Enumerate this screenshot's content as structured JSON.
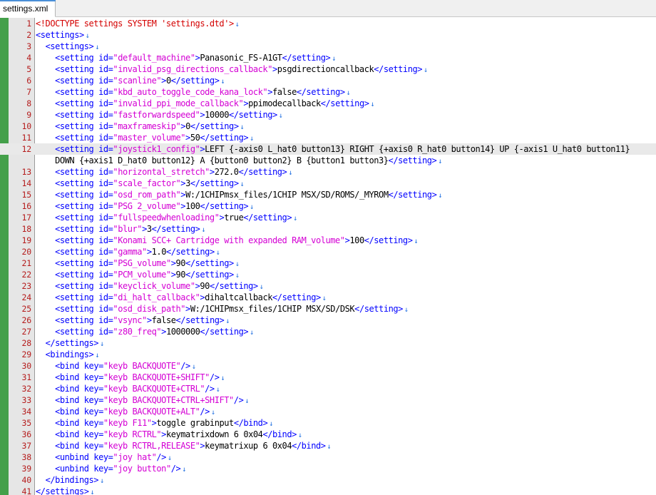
{
  "tab": {
    "title": "settings.xml"
  },
  "editor": {
    "current_line": 12,
    "eol_marker": "↓",
    "lines": [
      {
        "n": "1",
        "parts": [
          [
            "doc",
            "<!DOCTYPE settings SYSTEM 'settings.dtd'>"
          ]
        ]
      },
      {
        "n": "2",
        "parts": [
          [
            "tag",
            "<settings>"
          ]
        ]
      },
      {
        "n": "3",
        "parts": [
          [
            "txt",
            "  "
          ],
          [
            "tag",
            "<settings>"
          ]
        ]
      },
      {
        "n": "4",
        "parts": [
          [
            "txt",
            "    "
          ],
          [
            "tag",
            "<setting "
          ],
          [
            "attr",
            "id="
          ],
          [
            "val",
            "\"default_machine\""
          ],
          [
            "tag",
            ">"
          ],
          [
            "txt",
            "Panasonic_FS-A1GT"
          ],
          [
            "tag",
            "</setting>"
          ]
        ]
      },
      {
        "n": "5",
        "parts": [
          [
            "txt",
            "    "
          ],
          [
            "tag",
            "<setting "
          ],
          [
            "attr",
            "id="
          ],
          [
            "val",
            "\"invalid_psg_directions_callback\""
          ],
          [
            "tag",
            ">"
          ],
          [
            "txt",
            "psgdirectioncallback"
          ],
          [
            "tag",
            "</setting>"
          ]
        ]
      },
      {
        "n": "6",
        "parts": [
          [
            "txt",
            "    "
          ],
          [
            "tag",
            "<setting "
          ],
          [
            "attr",
            "id="
          ],
          [
            "val",
            "\"scanline\""
          ],
          [
            "tag",
            ">"
          ],
          [
            "txt",
            "0"
          ],
          [
            "tag",
            "</setting>"
          ]
        ]
      },
      {
        "n": "7",
        "parts": [
          [
            "txt",
            "    "
          ],
          [
            "tag",
            "<setting "
          ],
          [
            "attr",
            "id="
          ],
          [
            "val",
            "\"kbd_auto_toggle_code_kana_lock\""
          ],
          [
            "tag",
            ">"
          ],
          [
            "txt",
            "false"
          ],
          [
            "tag",
            "</setting>"
          ]
        ]
      },
      {
        "n": "8",
        "parts": [
          [
            "txt",
            "    "
          ],
          [
            "tag",
            "<setting "
          ],
          [
            "attr",
            "id="
          ],
          [
            "val",
            "\"invalid_ppi_mode_callback\""
          ],
          [
            "tag",
            ">"
          ],
          [
            "txt",
            "ppimodecallback"
          ],
          [
            "tag",
            "</setting>"
          ]
        ]
      },
      {
        "n": "9",
        "parts": [
          [
            "txt",
            "    "
          ],
          [
            "tag",
            "<setting "
          ],
          [
            "attr",
            "id="
          ],
          [
            "val",
            "\"fastforwardspeed\""
          ],
          [
            "tag",
            ">"
          ],
          [
            "txt",
            "10000"
          ],
          [
            "tag",
            "</setting>"
          ]
        ]
      },
      {
        "n": "10",
        "parts": [
          [
            "txt",
            "    "
          ],
          [
            "tag",
            "<setting "
          ],
          [
            "attr",
            "id="
          ],
          [
            "val",
            "\"maxframeskip\""
          ],
          [
            "tag",
            ">"
          ],
          [
            "txt",
            "0"
          ],
          [
            "tag",
            "</setting>"
          ]
        ]
      },
      {
        "n": "11",
        "parts": [
          [
            "txt",
            "    "
          ],
          [
            "tag",
            "<setting "
          ],
          [
            "attr",
            "id="
          ],
          [
            "val",
            "\"master_volume\""
          ],
          [
            "tag",
            ">"
          ],
          [
            "txt",
            "50"
          ],
          [
            "tag",
            "</setting>"
          ]
        ]
      },
      {
        "n": "12",
        "parts": [
          [
            "txt",
            "    "
          ],
          [
            "tag",
            "<setting "
          ],
          [
            "attr",
            "id="
          ],
          [
            "val",
            "\"joystick1_config\""
          ],
          [
            "tag",
            ">"
          ],
          [
            "txt",
            "LEFT {-axis0 L_hat0 button13} RIGHT {+axis0 R_hat0 button14} UP {-axis1 U_hat0 button11}"
          ]
        ],
        "noeol": true
      },
      {
        "n": "",
        "cont": true,
        "parts": [
          [
            "txt",
            "    DOWN {+axis1 D_hat0 button12} A {button0 button2} B {button1 button3}"
          ],
          [
            "tag",
            "</setting>"
          ]
        ]
      },
      {
        "n": "13",
        "parts": [
          [
            "txt",
            "    "
          ],
          [
            "tag",
            "<setting "
          ],
          [
            "attr",
            "id="
          ],
          [
            "val",
            "\"horizontal_stretch\""
          ],
          [
            "tag",
            ">"
          ],
          [
            "txt",
            "272.0"
          ],
          [
            "tag",
            "</setting>"
          ]
        ]
      },
      {
        "n": "14",
        "parts": [
          [
            "txt",
            "    "
          ],
          [
            "tag",
            "<setting "
          ],
          [
            "attr",
            "id="
          ],
          [
            "val",
            "\"scale_factor\""
          ],
          [
            "tag",
            ">"
          ],
          [
            "txt",
            "3"
          ],
          [
            "tag",
            "</setting>"
          ]
        ]
      },
      {
        "n": "15",
        "parts": [
          [
            "txt",
            "    "
          ],
          [
            "tag",
            "<setting "
          ],
          [
            "attr",
            "id="
          ],
          [
            "val",
            "\"osd_rom_path\""
          ],
          [
            "tag",
            ">"
          ],
          [
            "txt",
            "W:/1CHIPmsx_files/1CHIP MSX/SD/ROMS/_MYROM"
          ],
          [
            "tag",
            "</setting>"
          ]
        ]
      },
      {
        "n": "16",
        "parts": [
          [
            "txt",
            "    "
          ],
          [
            "tag",
            "<setting "
          ],
          [
            "attr",
            "id="
          ],
          [
            "val",
            "\"PSG 2_volume\""
          ],
          [
            "tag",
            ">"
          ],
          [
            "txt",
            "100"
          ],
          [
            "tag",
            "</setting>"
          ]
        ]
      },
      {
        "n": "17",
        "parts": [
          [
            "txt",
            "    "
          ],
          [
            "tag",
            "<setting "
          ],
          [
            "attr",
            "id="
          ],
          [
            "val",
            "\"fullspeedwhenloading\""
          ],
          [
            "tag",
            ">"
          ],
          [
            "txt",
            "true"
          ],
          [
            "tag",
            "</setting>"
          ]
        ]
      },
      {
        "n": "18",
        "parts": [
          [
            "txt",
            "    "
          ],
          [
            "tag",
            "<setting "
          ],
          [
            "attr",
            "id="
          ],
          [
            "val",
            "\"blur\""
          ],
          [
            "tag",
            ">"
          ],
          [
            "txt",
            "3"
          ],
          [
            "tag",
            "</setting>"
          ]
        ]
      },
      {
        "n": "19",
        "parts": [
          [
            "txt",
            "    "
          ],
          [
            "tag",
            "<setting "
          ],
          [
            "attr",
            "id="
          ],
          [
            "val",
            "\"Konami SCC+ Cartridge with expanded RAM_volume\""
          ],
          [
            "tag",
            ">"
          ],
          [
            "txt",
            "100"
          ],
          [
            "tag",
            "</setting>"
          ]
        ]
      },
      {
        "n": "20",
        "parts": [
          [
            "txt",
            "    "
          ],
          [
            "tag",
            "<setting "
          ],
          [
            "attr",
            "id="
          ],
          [
            "val",
            "\"gamma\""
          ],
          [
            "tag",
            ">"
          ],
          [
            "txt",
            "1.0"
          ],
          [
            "tag",
            "</setting>"
          ]
        ]
      },
      {
        "n": "21",
        "parts": [
          [
            "txt",
            "    "
          ],
          [
            "tag",
            "<setting "
          ],
          [
            "attr",
            "id="
          ],
          [
            "val",
            "\"PSG_volume\""
          ],
          [
            "tag",
            ">"
          ],
          [
            "txt",
            "90"
          ],
          [
            "tag",
            "</setting>"
          ]
        ]
      },
      {
        "n": "22",
        "parts": [
          [
            "txt",
            "    "
          ],
          [
            "tag",
            "<setting "
          ],
          [
            "attr",
            "id="
          ],
          [
            "val",
            "\"PCM_volume\""
          ],
          [
            "tag",
            ">"
          ],
          [
            "txt",
            "90"
          ],
          [
            "tag",
            "</setting>"
          ]
        ]
      },
      {
        "n": "23",
        "parts": [
          [
            "txt",
            "    "
          ],
          [
            "tag",
            "<setting "
          ],
          [
            "attr",
            "id="
          ],
          [
            "val",
            "\"keyclick_volume\""
          ],
          [
            "tag",
            ">"
          ],
          [
            "txt",
            "90"
          ],
          [
            "tag",
            "</setting>"
          ]
        ]
      },
      {
        "n": "24",
        "parts": [
          [
            "txt",
            "    "
          ],
          [
            "tag",
            "<setting "
          ],
          [
            "attr",
            "id="
          ],
          [
            "val",
            "\"di_halt_callback\""
          ],
          [
            "tag",
            ">"
          ],
          [
            "txt",
            "dihaltcallback"
          ],
          [
            "tag",
            "</setting>"
          ]
        ]
      },
      {
        "n": "25",
        "parts": [
          [
            "txt",
            "    "
          ],
          [
            "tag",
            "<setting "
          ],
          [
            "attr",
            "id="
          ],
          [
            "val",
            "\"osd_disk_path\""
          ],
          [
            "tag",
            ">"
          ],
          [
            "txt",
            "W:/1CHIPmsx_files/1CHIP MSX/SD/DSK"
          ],
          [
            "tag",
            "</setting>"
          ]
        ]
      },
      {
        "n": "26",
        "parts": [
          [
            "txt",
            "    "
          ],
          [
            "tag",
            "<setting "
          ],
          [
            "attr",
            "id="
          ],
          [
            "val",
            "\"vsync\""
          ],
          [
            "tag",
            ">"
          ],
          [
            "txt",
            "false"
          ],
          [
            "tag",
            "</setting>"
          ]
        ]
      },
      {
        "n": "27",
        "parts": [
          [
            "txt",
            "    "
          ],
          [
            "tag",
            "<setting "
          ],
          [
            "attr",
            "id="
          ],
          [
            "val",
            "\"z80_freq\""
          ],
          [
            "tag",
            ">"
          ],
          [
            "txt",
            "1000000"
          ],
          [
            "tag",
            "</setting>"
          ]
        ]
      },
      {
        "n": "28",
        "parts": [
          [
            "txt",
            "  "
          ],
          [
            "tag",
            "</settings>"
          ]
        ]
      },
      {
        "n": "29",
        "parts": [
          [
            "txt",
            "  "
          ],
          [
            "tag",
            "<bindings>"
          ]
        ]
      },
      {
        "n": "30",
        "parts": [
          [
            "txt",
            "    "
          ],
          [
            "tag",
            "<bind "
          ],
          [
            "attr",
            "key="
          ],
          [
            "val",
            "\"keyb BACKQUOTE\""
          ],
          [
            "tag",
            "/>"
          ]
        ]
      },
      {
        "n": "31",
        "parts": [
          [
            "txt",
            "    "
          ],
          [
            "tag",
            "<bind "
          ],
          [
            "attr",
            "key="
          ],
          [
            "val",
            "\"keyb BACKQUOTE+SHIFT\""
          ],
          [
            "tag",
            "/>"
          ]
        ]
      },
      {
        "n": "32",
        "parts": [
          [
            "txt",
            "    "
          ],
          [
            "tag",
            "<bind "
          ],
          [
            "attr",
            "key="
          ],
          [
            "val",
            "\"keyb BACKQUOTE+CTRL\""
          ],
          [
            "tag",
            "/>"
          ]
        ]
      },
      {
        "n": "33",
        "parts": [
          [
            "txt",
            "    "
          ],
          [
            "tag",
            "<bind "
          ],
          [
            "attr",
            "key="
          ],
          [
            "val",
            "\"keyb BACKQUOTE+CTRL+SHIFT\""
          ],
          [
            "tag",
            "/>"
          ]
        ]
      },
      {
        "n": "34",
        "parts": [
          [
            "txt",
            "    "
          ],
          [
            "tag",
            "<bind "
          ],
          [
            "attr",
            "key="
          ],
          [
            "val",
            "\"keyb BACKQUOTE+ALT\""
          ],
          [
            "tag",
            "/>"
          ]
        ]
      },
      {
        "n": "35",
        "parts": [
          [
            "txt",
            "    "
          ],
          [
            "tag",
            "<bind "
          ],
          [
            "attr",
            "key="
          ],
          [
            "val",
            "\"keyb F11\""
          ],
          [
            "tag",
            ">"
          ],
          [
            "txt",
            "toggle grabinput"
          ],
          [
            "tag",
            "</bind>"
          ]
        ]
      },
      {
        "n": "36",
        "parts": [
          [
            "txt",
            "    "
          ],
          [
            "tag",
            "<bind "
          ],
          [
            "attr",
            "key="
          ],
          [
            "val",
            "\"keyb RCTRL\""
          ],
          [
            "tag",
            ">"
          ],
          [
            "txt",
            "keymatrixdown 6 0x04"
          ],
          [
            "tag",
            "</bind>"
          ]
        ]
      },
      {
        "n": "37",
        "parts": [
          [
            "txt",
            "    "
          ],
          [
            "tag",
            "<bind "
          ],
          [
            "attr",
            "key="
          ],
          [
            "val",
            "\"keyb RCTRL,RELEASE\""
          ],
          [
            "tag",
            ">"
          ],
          [
            "txt",
            "keymatrixup 6 0x04"
          ],
          [
            "tag",
            "</bind>"
          ]
        ]
      },
      {
        "n": "38",
        "parts": [
          [
            "txt",
            "    "
          ],
          [
            "tag",
            "<unbind "
          ],
          [
            "attr",
            "key="
          ],
          [
            "val",
            "\"joy hat\""
          ],
          [
            "tag",
            "/>"
          ]
        ]
      },
      {
        "n": "39",
        "parts": [
          [
            "txt",
            "    "
          ],
          [
            "tag",
            "<unbind "
          ],
          [
            "attr",
            "key="
          ],
          [
            "val",
            "\"joy button\""
          ],
          [
            "tag",
            "/>"
          ]
        ]
      },
      {
        "n": "40",
        "parts": [
          [
            "txt",
            "  "
          ],
          [
            "tag",
            "</bindings>"
          ]
        ]
      },
      {
        "n": "41",
        "parts": [
          [
            "tag",
            "</settings>"
          ]
        ]
      }
    ]
  }
}
